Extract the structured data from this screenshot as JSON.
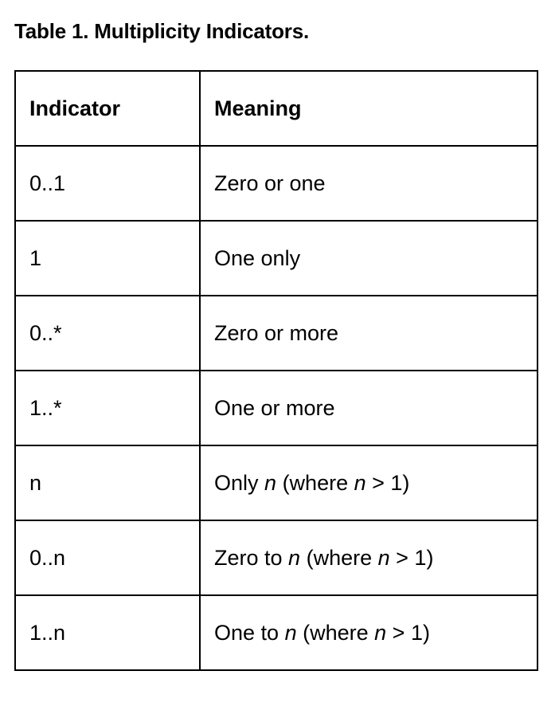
{
  "caption": "Table 1. Multiplicity Indicators.",
  "table": {
    "headers": [
      "Indicator",
      "Meaning"
    ],
    "rows": [
      {
        "indicator": "0..1",
        "meaning": [
          {
            "text": "Zero or one",
            "italic": false
          }
        ]
      },
      {
        "indicator": "1",
        "meaning": [
          {
            "text": "One only",
            "italic": false
          }
        ]
      },
      {
        "indicator": "0..*",
        "meaning": [
          {
            "text": "Zero or more",
            "italic": false
          }
        ]
      },
      {
        "indicator": "1..*",
        "meaning": [
          {
            "text": "One or more",
            "italic": false
          }
        ]
      },
      {
        "indicator": "n",
        "meaning": [
          {
            "text": "Only ",
            "italic": false
          },
          {
            "text": "n",
            "italic": true
          },
          {
            "text": " (where ",
            "italic": false
          },
          {
            "text": "n",
            "italic": true
          },
          {
            "text": " > 1)",
            "italic": false
          }
        ]
      },
      {
        "indicator": "0..n",
        "meaning": [
          {
            "text": "Zero to ",
            "italic": false
          },
          {
            "text": "n",
            "italic": true
          },
          {
            "text": " (where ",
            "italic": false
          },
          {
            "text": "n",
            "italic": true
          },
          {
            "text": " > 1)",
            "italic": false
          }
        ]
      },
      {
        "indicator": "1..n",
        "meaning": [
          {
            "text": "One to ",
            "italic": false
          },
          {
            "text": "n",
            "italic": true
          },
          {
            "text": " (where ",
            "italic": false
          },
          {
            "text": "n",
            "italic": true
          },
          {
            "text": " > 1)",
            "italic": false
          }
        ]
      }
    ]
  }
}
